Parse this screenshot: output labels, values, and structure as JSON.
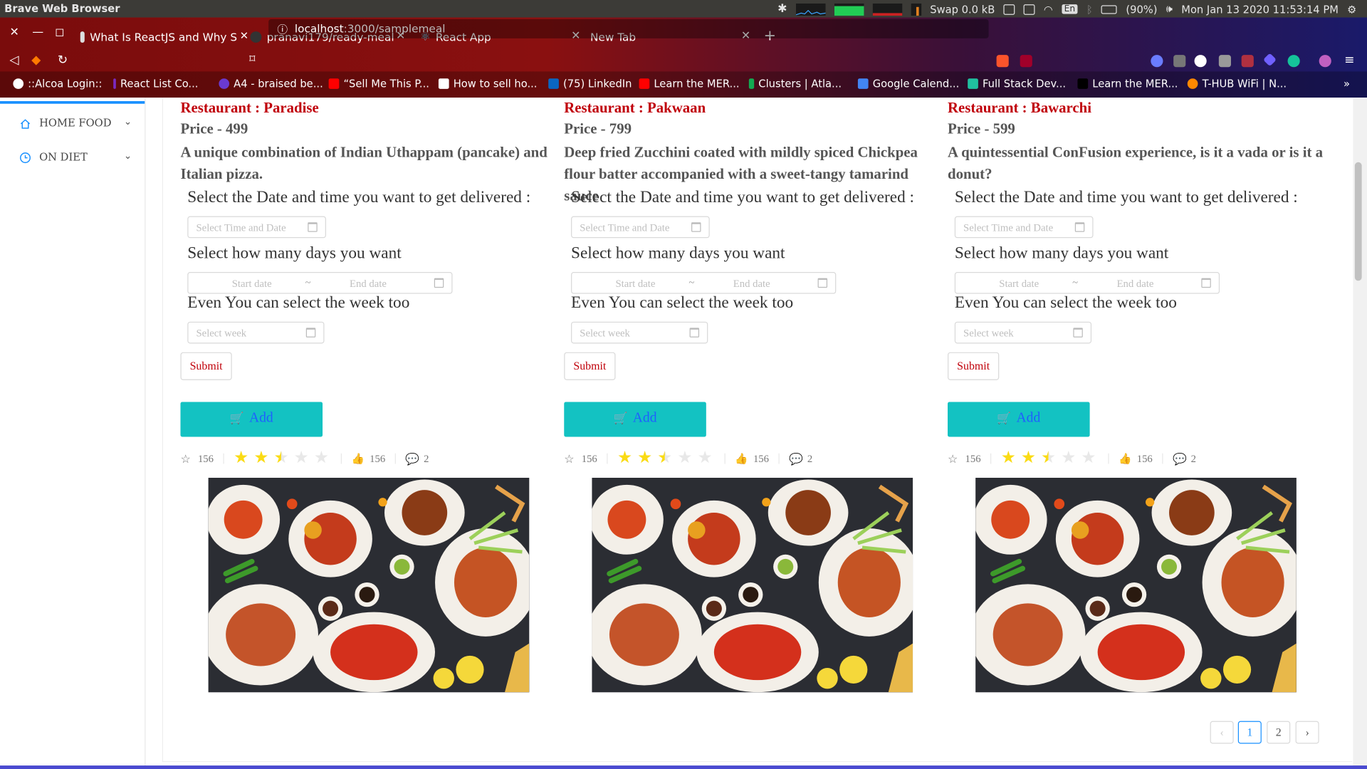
{
  "os": {
    "app_title": "Brave Web Browser",
    "swap": "Swap 0.0 kB",
    "keyboard": "En",
    "battery": "(90%)",
    "datetime": "Mon Jan 13 2020 11:53:14 PM"
  },
  "browser": {
    "tabs": [
      {
        "label": "What Is ReactJS and Why S",
        "icon": "blog-icon"
      },
      {
        "label": "pranavi179/ready-meal",
        "icon": "github-icon"
      },
      {
        "label": "React App",
        "icon": "react-icon"
      },
      {
        "label": "New Tab",
        "icon": ""
      }
    ],
    "url_host": "localhost",
    "url_path": ":3000/samplemeal",
    "bookmarks": [
      "::Alcoa Login::",
      "React List Co...",
      "A4 - braised be...",
      "“Sell Me This P...",
      "How to sell ho...",
      "(75) LinkedIn",
      "Learn the MER...",
      "Clusters | Atla...",
      "Google Calend...",
      "Full Stack Dev...",
      "Learn the MER...",
      "T-HUB WiFi | N..."
    ],
    "bookmarks_more": "»"
  },
  "sidebar": {
    "items": [
      {
        "label": "HOME FOOD",
        "icon": "home-icon"
      },
      {
        "label": "ON DIET",
        "icon": "clock-icon"
      }
    ]
  },
  "labels": {
    "date_time_question": "Select the Date and time you want to get delivered :",
    "date_time_placeholder": "Select Time and Date",
    "days_question": "Select how many days you want",
    "start_placeholder": "Start date",
    "range_separator": "~",
    "end_placeholder": "End date",
    "week_question": "Even You can select the week too",
    "week_placeholder": "Select week",
    "submit": "Submit",
    "add": "Add"
  },
  "cards": [
    {
      "restaurant": "Restaurant : Paradise",
      "price": "Price - 499",
      "description": "A unique combination of Indian Uthappam (pancake) and Italian pizza.",
      "star_count": "156",
      "rating": 2.5,
      "likes": "156",
      "comments": "2"
    },
    {
      "restaurant": "Restaurant : Pakwaan",
      "price": "Price - 799",
      "description": "Deep fried Zucchini coated with mildly spiced Chickpea flour batter accompanied with a sweet-tangy tamarind sauce",
      "star_count": "156",
      "rating": 2.5,
      "likes": "156",
      "comments": "2"
    },
    {
      "restaurant": "Restaurant : Bawarchi",
      "price": "Price - 599",
      "description": "A quintessential ConFusion experience, is it a vada or is it a donut?",
      "star_count": "156",
      "rating": 2.5,
      "likes": "156",
      "comments": "2"
    }
  ],
  "pagination": {
    "prev": "‹",
    "pages": [
      "1",
      "2"
    ],
    "current": "1",
    "next": "›"
  },
  "colors": {
    "accent": "#1890ff",
    "restaurant_title": "#c0000a",
    "add_button": "#13c2c2",
    "star": "#fadb14"
  }
}
